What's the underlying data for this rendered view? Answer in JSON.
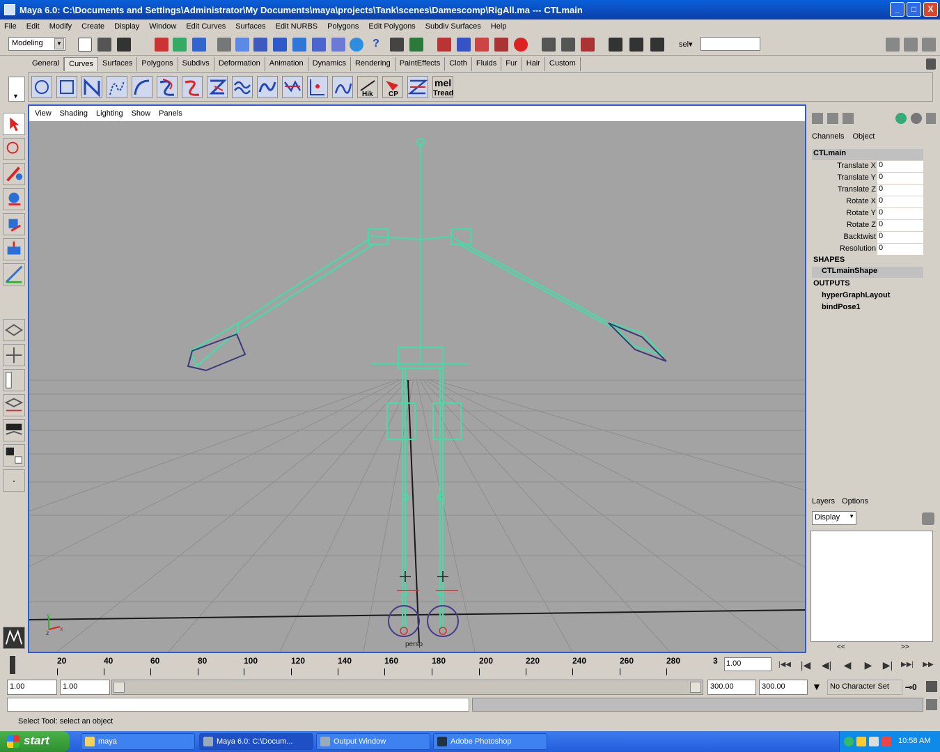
{
  "window": {
    "title": "Maya 6.0: C:\\Documents and Settings\\Administrator\\My Documents\\maya\\projects\\Tank\\scenes\\Damescomp\\RigAll.ma  ---  CTLmain",
    "minimize": "_",
    "maximize": "□",
    "close": "X"
  },
  "menubar": [
    "File",
    "Edit",
    "Modify",
    "Create",
    "Display",
    "Window",
    "Edit Curves",
    "Surfaces",
    "Edit NURBS",
    "Polygons",
    "Edit Polygons",
    "Subdiv Surfaces",
    "Help"
  ],
  "statusline": {
    "mode": "Modeling",
    "sel_label": "sel▾",
    "sel_value": ""
  },
  "shelf_tabs": [
    "General",
    "Curves",
    "Surfaces",
    "Polygons",
    "Subdivs",
    "Deformation",
    "Animation",
    "Dynamics",
    "Rendering",
    "PaintEffects",
    "Cloth",
    "Fluids",
    "Fur",
    "Hair",
    "Custom"
  ],
  "shelf_active_tab": "Curves",
  "shelf_buttons": [
    "circle-curve-icon",
    "square-curve-icon",
    "cv-curve-icon",
    "ep-curve-icon",
    "arc-curve-icon",
    "offset-curve-icon",
    "attach-curve-icon",
    "detach-curve-icon",
    "rebuild-curve-icon",
    "smooth-curve-icon",
    "fillet-curve-icon",
    "insert-knot-icon",
    "extend-curve-icon",
    "hik-icon",
    "cp-icon",
    "curve-tool-icon",
    "mel-tread-icon"
  ],
  "shelf_labels": {
    "hik": "Hik",
    "cp": "CP",
    "mel_top": "mel",
    "mel_bottom": "Tread"
  },
  "panel_menu": [
    "View",
    "Shading",
    "Lighting",
    "Show",
    "Panels"
  ],
  "viewport": {
    "camera_label": "persp",
    "axis_x": "x",
    "axis_y": "y",
    "axis_z": "z"
  },
  "channel_box": {
    "tabs": [
      "Channels",
      "Object"
    ],
    "node_name": "CTLmain",
    "attributes": [
      {
        "label": "Translate X",
        "value": "0"
      },
      {
        "label": "Translate Y",
        "value": "0"
      },
      {
        "label": "Translate Z",
        "value": "0"
      },
      {
        "label": "Rotate X",
        "value": "0"
      },
      {
        "label": "Rotate Y",
        "value": "0"
      },
      {
        "label": "Rotate Z",
        "value": "0"
      },
      {
        "label": "Backtwist",
        "value": "0"
      },
      {
        "label": "Resolution",
        "value": "0"
      }
    ],
    "shapes_header": "SHAPES",
    "shape_name": "CTLmainShape",
    "outputs_header": "OUTPUTS",
    "outputs": [
      "hyperGraphLayout",
      "bindPose1"
    ]
  },
  "layer_editor": {
    "tabs": [
      "Layers",
      "Options"
    ],
    "display": "Display",
    "scroll_left": "<<",
    "scroll_right": ">>"
  },
  "time_slider": {
    "ticks": [
      "20",
      "40",
      "60",
      "80",
      "100",
      "120",
      "140",
      "160",
      "180",
      "200",
      "220",
      "240",
      "260",
      "280",
      "3"
    ],
    "current_frame": "1.00",
    "playback_buttons": [
      "|◀◀",
      "|◀",
      "◀|",
      "◀",
      "▶",
      "▶|",
      "▶▶|",
      "▶▶"
    ]
  },
  "range_slider": {
    "start_time": "1.00",
    "playback_start": "1.00",
    "playback_end": "300.00",
    "end_time": "300.00",
    "character_set": "No Character Set",
    "key_icon": "⊸0"
  },
  "help_line": "Select Tool: select an object",
  "taskbar": {
    "start": "start",
    "items": [
      "maya",
      "Maya 6.0: C:\\Docum...",
      "Output Window",
      "Adobe Photoshop"
    ],
    "clock": "10:58 AM"
  }
}
